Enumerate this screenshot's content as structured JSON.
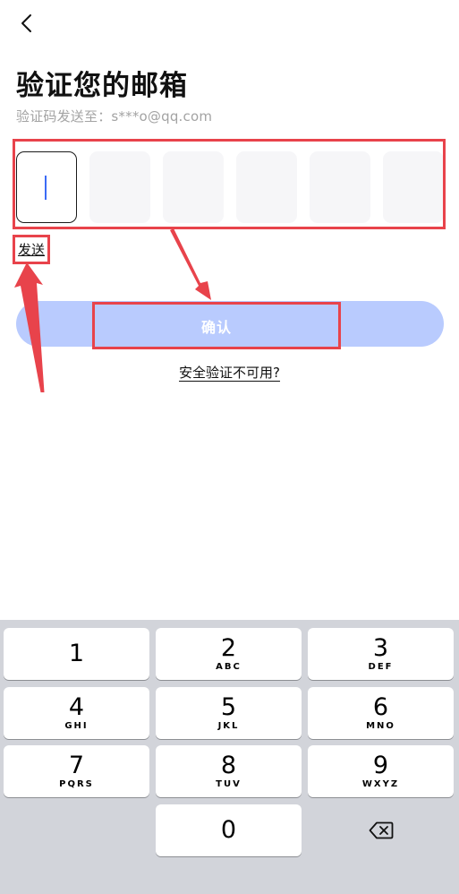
{
  "header": {
    "back_icon": "chevron-left-icon",
    "title": "验证您的邮箱",
    "subtitle": "验证码发送至：s***o@qq.com"
  },
  "code_input": {
    "digit_count": 6,
    "active_index": 0
  },
  "send_label": "发送",
  "confirm_label": "确认",
  "unavailable_label": "安全验证不可用?",
  "colors": {
    "accent_blue": "#3b6bf5",
    "confirm_button_bg": "#b9cbfe",
    "annotation_red": "#e8434b",
    "keyboard_bg": "#d2d4da"
  },
  "keyboard": {
    "keys": [
      {
        "digit": "1",
        "letters": ""
      },
      {
        "digit": "2",
        "letters": "ABC"
      },
      {
        "digit": "3",
        "letters": "DEF"
      },
      {
        "digit": "4",
        "letters": "GHI"
      },
      {
        "digit": "5",
        "letters": "JKL"
      },
      {
        "digit": "6",
        "letters": "MNO"
      },
      {
        "digit": "7",
        "letters": "PQRS"
      },
      {
        "digit": "8",
        "letters": "TUV"
      },
      {
        "digit": "9",
        "letters": "WXYZ"
      },
      {
        "digit": "0",
        "letters": ""
      }
    ],
    "delete_icon": "backspace-icon"
  }
}
